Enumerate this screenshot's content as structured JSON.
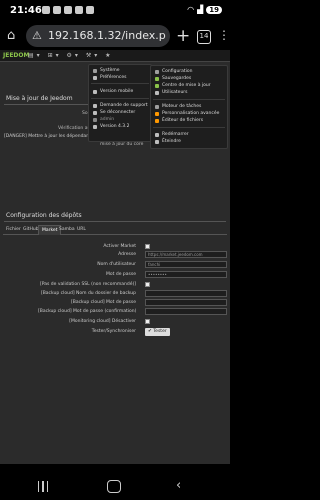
{
  "status_bar": {
    "time": "21:46",
    "battery": "19"
  },
  "browser": {
    "url": "192.168.1.32/index.p",
    "tab_count": "14"
  },
  "jeedom": {
    "logo": "JEEDOM",
    "update_title": "Mise à jour de Jeedom",
    "update_label_1": "Sou",
    "update_label_2": "Vérification autom",
    "update_warning": "[DANGER] Mettre à jour les dépendances PHP (composer) après chaque",
    "update_check_label": "mise à jour du core",
    "deps_title": "Configuration des dépôts",
    "tabs": [
      "Fichier",
      "GitHub",
      "Market",
      "Samba",
      "URL"
    ],
    "active_tab": "Market",
    "fields": [
      {
        "label": "Activer Market",
        "type": "checkbox"
      },
      {
        "label": "Adresse",
        "type": "input",
        "value": "https://market.jeedom.com"
      },
      {
        "label": "Nom d'utilisateur",
        "type": "input",
        "value": "fanchi"
      },
      {
        "label": "Mot de passe",
        "type": "input",
        "value": "••••••••"
      },
      {
        "label": "[Pas de validation SSL (non recommandé)]",
        "type": "checkbox"
      },
      {
        "label": "[Backup cloud] Nom du dossier de backup",
        "type": "input",
        "value": ""
      },
      {
        "label": "[Backup cloud] Mot de passe",
        "type": "input",
        "value": ""
      },
      {
        "label": "[Backup cloud] Mot de passe (confirmation)",
        "type": "input",
        "value": ""
      },
      {
        "label": "[Monitoring cloud] Désactiver",
        "type": "checkbox"
      },
      {
        "label": "Tester/Synchroniser",
        "type": "button",
        "value": "✔ Tester"
      }
    ]
  },
  "user_menu": {
    "items": [
      "Système",
      "Préférences",
      "Version mobile",
      "Demande de support",
      "Se déconnecter",
      "admin",
      "Version 4.3.2"
    ]
  },
  "settings_menu": {
    "items": [
      "Configuration",
      "Sauvegardes",
      "Centre de mise à jour",
      "Utilisateurs",
      "Moteur de tâches",
      "Personnalisation avancée",
      "Éditeur de fichiers",
      "Redémarrer",
      "Éteindre"
    ]
  }
}
